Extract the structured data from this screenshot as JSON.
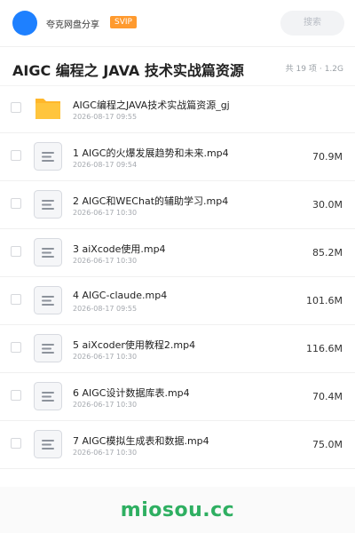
{
  "header": {
    "share_name": "夸克网盘分享",
    "badge": "SVIP",
    "search_placeholder": "搜索"
  },
  "title": {
    "text": "AIGC 编程之 JAVA 技术实战篇资源",
    "count": "共 19 项",
    "separator": "·",
    "size": "1.2G"
  },
  "files": [
    {
      "type": "folder",
      "name": "AIGC编程之JAVA技术实战篇资源_gj",
      "date": "2026-08-17 09:55",
      "size": ""
    },
    {
      "type": "file",
      "name": "1 AIGC的火爆发展趋势和未来.mp4",
      "date": "2026-08-17 09:54",
      "size": "70.9M"
    },
    {
      "type": "file",
      "name": "2 AIGC和WEChat的辅助学习.mp4",
      "date": "2026-06-17 10:30",
      "size": "30.0M"
    },
    {
      "type": "file",
      "name": "3 aiXcode使用.mp4",
      "date": "2026-06-17 10:30",
      "size": "85.2M"
    },
    {
      "type": "file",
      "name": "4 AIGC-claude.mp4",
      "date": "2026-08-17 09:55",
      "size": "101.6M"
    },
    {
      "type": "file",
      "name": "5 aiXcoder使用教程2.mp4",
      "date": "2026-06-17 10:30",
      "size": "116.6M"
    },
    {
      "type": "file",
      "name": "6 AIGC设计数据库表.mp4",
      "date": "2026-06-17 10:30",
      "size": "70.4M"
    },
    {
      "type": "file",
      "name": "7 AIGC模拟生成表和数据.mp4",
      "date": "2026-06-17 10:30",
      "size": "75.0M"
    }
  ],
  "watermark": "miosou.cc",
  "colors": {
    "accent": "#1e80ff",
    "badge": "#ff9a2e",
    "folder": "#ffc53d",
    "watermark": "#2eaf61"
  },
  "icons": {
    "folder": "folder-icon",
    "file": "video-file-icon"
  }
}
